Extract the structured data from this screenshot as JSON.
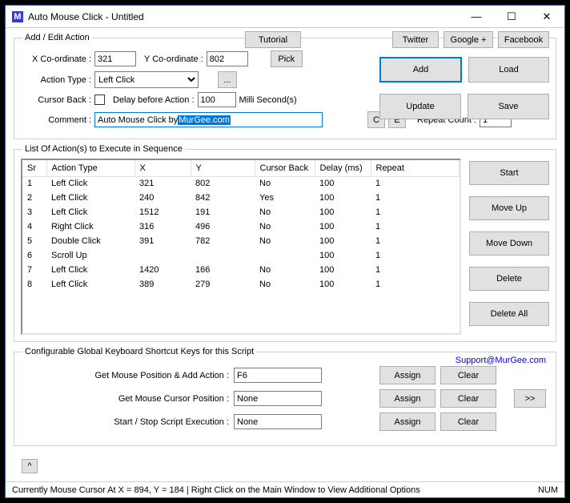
{
  "titlebar": {
    "app": "M",
    "title": "Auto Mouse Click - Untitled"
  },
  "topLinks": {
    "tutorial": "Tutorial",
    "twitter": "Twitter",
    "google": "Google +",
    "facebook": "Facebook"
  },
  "addEdit": {
    "legend": "Add / Edit Action",
    "xLabel": "X Co-ordinate :",
    "xVal": "321",
    "yLabel": "Y Co-ordinate :",
    "yVal": "802",
    "pick": "Pick",
    "actionTypeLabel": "Action Type :",
    "actionType": "Left Click",
    "ellipsis": "...",
    "cursorBackLabel": "Cursor Back :",
    "delayLabel": "Delay before Action :",
    "delayVal": "100",
    "delayUnit": "Milli Second(s)",
    "commentLabel": "Comment :",
    "commentPlain": "Auto Mouse Click by ",
    "commentSel": "MurGee.com",
    "cBtn": "C",
    "eBtn": "E",
    "repeatLabel": "Repeat Count :",
    "repeatVal": "1"
  },
  "rightBtns": {
    "add": "Add",
    "load": "Load",
    "update": "Update",
    "save": "Save"
  },
  "list": {
    "legend": "List Of Action(s) to Execute in Sequence",
    "cols": {
      "sr": "Sr",
      "type": "Action Type",
      "x": "X",
      "y": "Y",
      "cb": "Cursor Back",
      "delay": "Delay (ms)",
      "repeat": "Repeat"
    },
    "rows": [
      {
        "sr": "1",
        "type": "Left Click",
        "x": "321",
        "y": "802",
        "cb": "No",
        "delay": "100",
        "repeat": "1"
      },
      {
        "sr": "2",
        "type": "Left Click",
        "x": "240",
        "y": "842",
        "cb": "Yes",
        "delay": "100",
        "repeat": "1"
      },
      {
        "sr": "3",
        "type": "Left Click",
        "x": "1512",
        "y": "191",
        "cb": "No",
        "delay": "100",
        "repeat": "1"
      },
      {
        "sr": "4",
        "type": "Right Click",
        "x": "316",
        "y": "496",
        "cb": "No",
        "delay": "100",
        "repeat": "1"
      },
      {
        "sr": "5",
        "type": "Double Click",
        "x": "391",
        "y": "782",
        "cb": "No",
        "delay": "100",
        "repeat": "1"
      },
      {
        "sr": "6",
        "type": "Scroll Up",
        "x": "",
        "y": "",
        "cb": "",
        "delay": "100",
        "repeat": "1"
      },
      {
        "sr": "7",
        "type": "Left Click",
        "x": "1420",
        "y": "166",
        "cb": "No",
        "delay": "100",
        "repeat": "1"
      },
      {
        "sr": "8",
        "type": "Left Click",
        "x": "389",
        "y": "279",
        "cb": "No",
        "delay": "100",
        "repeat": "1"
      }
    ],
    "side": {
      "start": "Start",
      "moveUp": "Move Up",
      "moveDown": "Move Down",
      "delete": "Delete",
      "deleteAll": "Delete All"
    }
  },
  "cfg": {
    "legend": "Configurable Global Keyboard Shortcut Keys for this Script",
    "support": "Support@MurGee.com",
    "r1Label": "Get Mouse Position & Add Action :",
    "r1Val": "F6",
    "r2Label": "Get Mouse Cursor Position :",
    "r2Val": "None",
    "r3Label": "Start / Stop Script Execution :",
    "r3Val": "None",
    "assign": "Assign",
    "clear": "Clear",
    "more": ">>",
    "collapse": "^"
  },
  "status": {
    "text": "Currently Mouse Cursor At X = 894, Y = 184 | Right Click on the Main Window to View Additional Options",
    "num": "NUM"
  }
}
